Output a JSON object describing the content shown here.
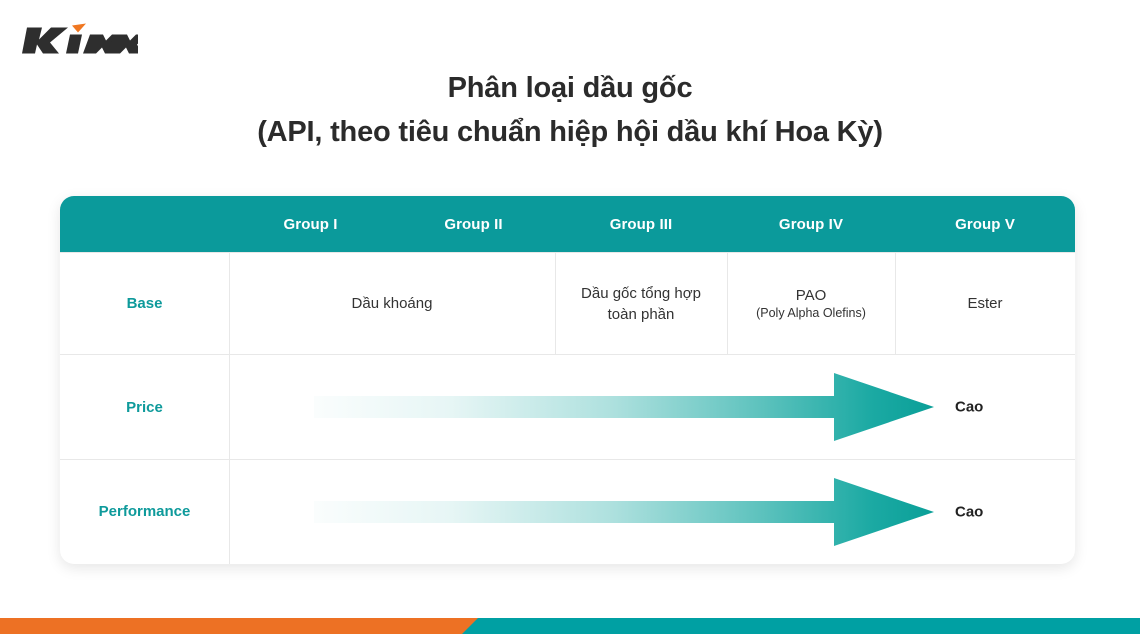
{
  "brand": {
    "logo_text": "Kixx",
    "logo_icon": "kixx-wordmark-logo",
    "logo_color": "#2e2e2e",
    "accent_color": "#f07721"
  },
  "title": {
    "line1": "Phân loại dầu gốc",
    "line2": "(API, theo tiêu chuẩn hiệp hội dầu khí Hoa Kỳ)"
  },
  "table": {
    "header": {
      "corner_label": "",
      "columns": [
        "Group I",
        "Group II",
        "Group III",
        "Group IV",
        "Group V"
      ]
    },
    "rows": [
      {
        "label": "Base",
        "cells": {
          "mineral": "Dầu khoáng",
          "synthetic_line1": "Dầu gốc tổng hợp",
          "synthetic_line2": "toàn phần",
          "pao_main": "PAO",
          "pao_sub": "(Poly Alpha Olefins)",
          "ester": "Ester"
        }
      },
      {
        "label": "Price",
        "arrow_end_label": "Cao"
      },
      {
        "label": "Performance",
        "arrow_end_label": "Cao"
      }
    ]
  },
  "colors": {
    "header_teal": "#0b9a9b",
    "label_teal": "#0e9a9b",
    "arrow_teal": "#0aa39c",
    "bar_orange": "#ed7124",
    "bar_teal": "#00a0a3",
    "text_dark": "#2b2b2b",
    "divider": "#e8e8e8"
  },
  "bottom_bar": {
    "orange_label": "orange-bar-segment",
    "teal_label": "teal-bar-segment"
  }
}
